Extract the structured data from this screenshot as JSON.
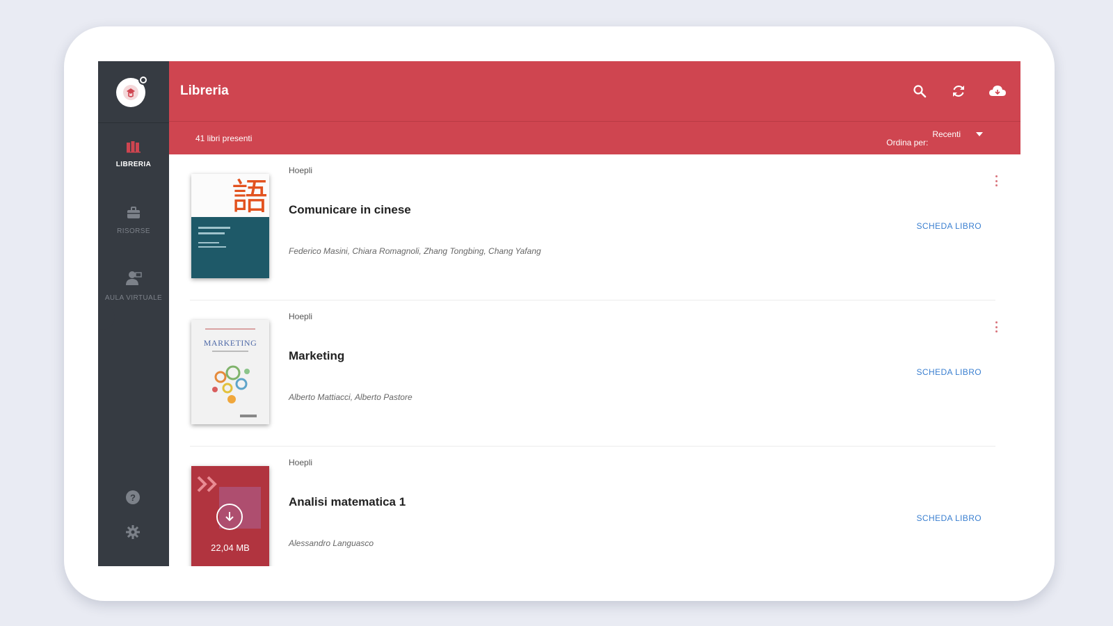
{
  "app": {
    "title": "Libreria"
  },
  "sidebar": {
    "items": [
      {
        "label": "LIBRERIA",
        "icon": "books-icon",
        "active": true
      },
      {
        "label": "RISORSE",
        "icon": "briefcase-icon",
        "active": false
      },
      {
        "label": "AULA VIRTUALE",
        "icon": "classroom-icon",
        "active": false
      }
    ],
    "bottom_icons": [
      "help-icon",
      "settings-icon"
    ]
  },
  "toolbar": {
    "icons": [
      "search-icon",
      "refresh-icon",
      "cloud-icon"
    ]
  },
  "subbar": {
    "count_text": "41 libri presenti",
    "sort_label": "Ordina per:",
    "sort_value": "Recenti"
  },
  "books": [
    {
      "publisher": "Hoepli",
      "title": "Comunicare in cinese",
      "authors": "Federico Masini, Chiara Romagnoli, Zhang Tongbing, Chang Yafang",
      "action": "SCHEDA LIBRO",
      "cover_glyph": "語"
    },
    {
      "publisher": "Hoepli",
      "title": "Marketing",
      "authors": "Alberto Mattiacci, Alberto Pastore",
      "action": "SCHEDA LIBRO",
      "cover_title": "MARKETING"
    },
    {
      "publisher": "Hoepli",
      "title": "Analisi matematica 1",
      "authors": "Alessandro Languasco",
      "action": "SCHEDA LIBRO",
      "download_size": "22,04 MB"
    }
  ],
  "colors": {
    "accent": "#cf4550",
    "sidebar": "#363b42",
    "link": "#3a7fd0",
    "background": "#e9ebf3"
  }
}
